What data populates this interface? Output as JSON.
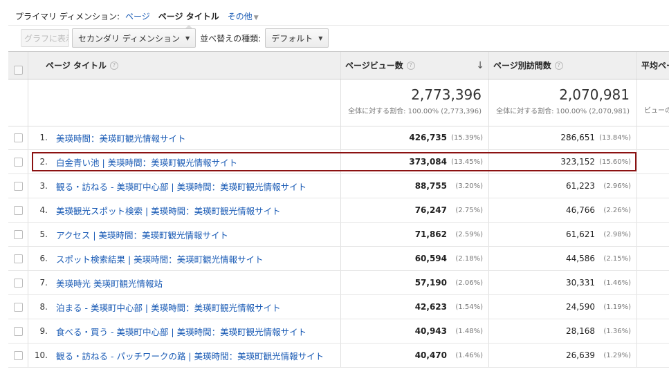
{
  "primary_dimension": {
    "label": "プライマリ ディメンション:",
    "options": [
      "ページ",
      "ページ タイトル"
    ],
    "more": "その他"
  },
  "toolbar": {
    "graph_button": "グラフに表示",
    "secondary_dimension": "セカンダリ ディメンション",
    "sort_label": "並べ替えの種類:",
    "sort_value": "デフォルト"
  },
  "table": {
    "headers": {
      "title": "ページ タイトル",
      "pageviews": "ページビュー数",
      "unique_pageviews": "ページ別訪問数",
      "avg": "平均ペー"
    },
    "totals": {
      "pageviews": "2,773,396",
      "pageviews_pct": "全体に対する割合: 100.00% (2,773,396)",
      "unique_pageviews": "2,070,981",
      "unique_pageviews_pct": "全体に対する割合: 100.00% (2,070,981)",
      "avg_pct": "ビューの"
    },
    "rows": [
      {
        "idx": "1.",
        "title": "美瑛時間：美瑛町観光情報サイト",
        "pv": "426,735",
        "pv_pct": "(15.39%)",
        "uv": "286,651",
        "uv_pct": "(13.84%)"
      },
      {
        "idx": "2.",
        "title": "白金青い池 | 美瑛時間：美瑛町観光情報サイト",
        "pv": "373,084",
        "pv_pct": "(13.45%)",
        "uv": "323,152",
        "uv_pct": "(15.60%)"
      },
      {
        "idx": "3.",
        "title": "観る・訪ねる - 美瑛町中心部 | 美瑛時間：美瑛町観光情報サイト",
        "pv": "88,755",
        "pv_pct": "(3.20%)",
        "uv": "61,223",
        "uv_pct": "(2.96%)"
      },
      {
        "idx": "4.",
        "title": "美瑛観光スポット検索 | 美瑛時間：美瑛町観光情報サイト",
        "pv": "76,247",
        "pv_pct": "(2.75%)",
        "uv": "46,766",
        "uv_pct": "(2.26%)"
      },
      {
        "idx": "5.",
        "title": "アクセス | 美瑛時間：美瑛町観光情報サイト",
        "pv": "71,862",
        "pv_pct": "(2.59%)",
        "uv": "61,621",
        "uv_pct": "(2.98%)"
      },
      {
        "idx": "6.",
        "title": "スポット検索結果 | 美瑛時間：美瑛町観光情報サイト",
        "pv": "60,594",
        "pv_pct": "(2.18%)",
        "uv": "44,586",
        "uv_pct": "(2.15%)"
      },
      {
        "idx": "7.",
        "title": "美瑛時光 美瑛町観光情報站",
        "pv": "57,190",
        "pv_pct": "(2.06%)",
        "uv": "30,331",
        "uv_pct": "(1.46%)"
      },
      {
        "idx": "8.",
        "title": "泊まる - 美瑛町中心部 | 美瑛時間：美瑛町観光情報サイト",
        "pv": "42,623",
        "pv_pct": "(1.54%)",
        "uv": "24,590",
        "uv_pct": "(1.19%)"
      },
      {
        "idx": "9.",
        "title": "食べる・買う - 美瑛町中心部 | 美瑛時間：美瑛町観光情報サイト",
        "pv": "40,943",
        "pv_pct": "(1.48%)",
        "uv": "28,168",
        "uv_pct": "(1.36%)"
      },
      {
        "idx": "10.",
        "title": "観る・訪ねる - パッチワークの路 | 美瑛時間：美瑛町観光情報サイト",
        "pv": "40,470",
        "pv_pct": "(1.46%)",
        "uv": "26,639",
        "uv_pct": "(1.29%)"
      }
    ]
  },
  "colors": {
    "link": "#1a5bb5",
    "highlight_border": "#8b1111"
  }
}
